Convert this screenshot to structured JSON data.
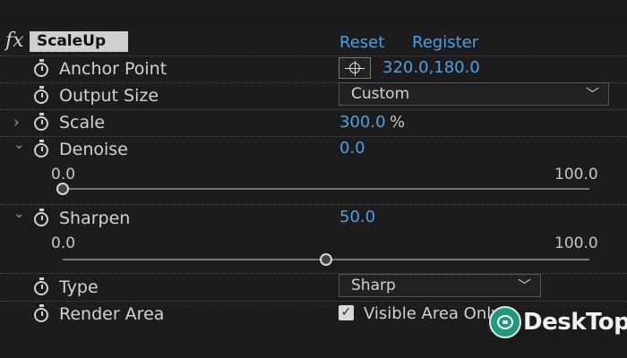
{
  "effect": {
    "fx_label": "fx",
    "name": "ScaleUp",
    "reset_label": "Reset",
    "register_label": "Register"
  },
  "properties": {
    "anchor_point": {
      "label": "Anchor Point",
      "value": "320.0,180.0"
    },
    "output_size": {
      "label": "Output Size",
      "selected": "Custom"
    },
    "scale": {
      "label": "Scale",
      "value": "300.0",
      "unit": "%"
    },
    "denoise": {
      "label": "Denoise",
      "value": "0.0",
      "min_label": "0.0",
      "max_label": "100.0",
      "slider_fraction": 0.0
    },
    "sharpen": {
      "label": "Sharpen",
      "value": "50.0",
      "min_label": "0.0",
      "max_label": "100.0",
      "slider_fraction": 0.5
    },
    "type": {
      "label": "Type",
      "selected": "Sharp"
    },
    "render_area": {
      "label": "Render Area",
      "checkbox_label": "Visible Area Only",
      "checked": true
    }
  },
  "watermark": {
    "text": "DeskTop"
  },
  "icons": {
    "stopwatch": "stopwatch-icon",
    "twirl_closed": "›",
    "twirl_open": "⌄",
    "chevron": "﹀",
    "check": "✓"
  },
  "colors": {
    "value_blue": "#4f9fe0",
    "background": "#1c1c1c",
    "watermark_green": "#1f9a7c"
  }
}
